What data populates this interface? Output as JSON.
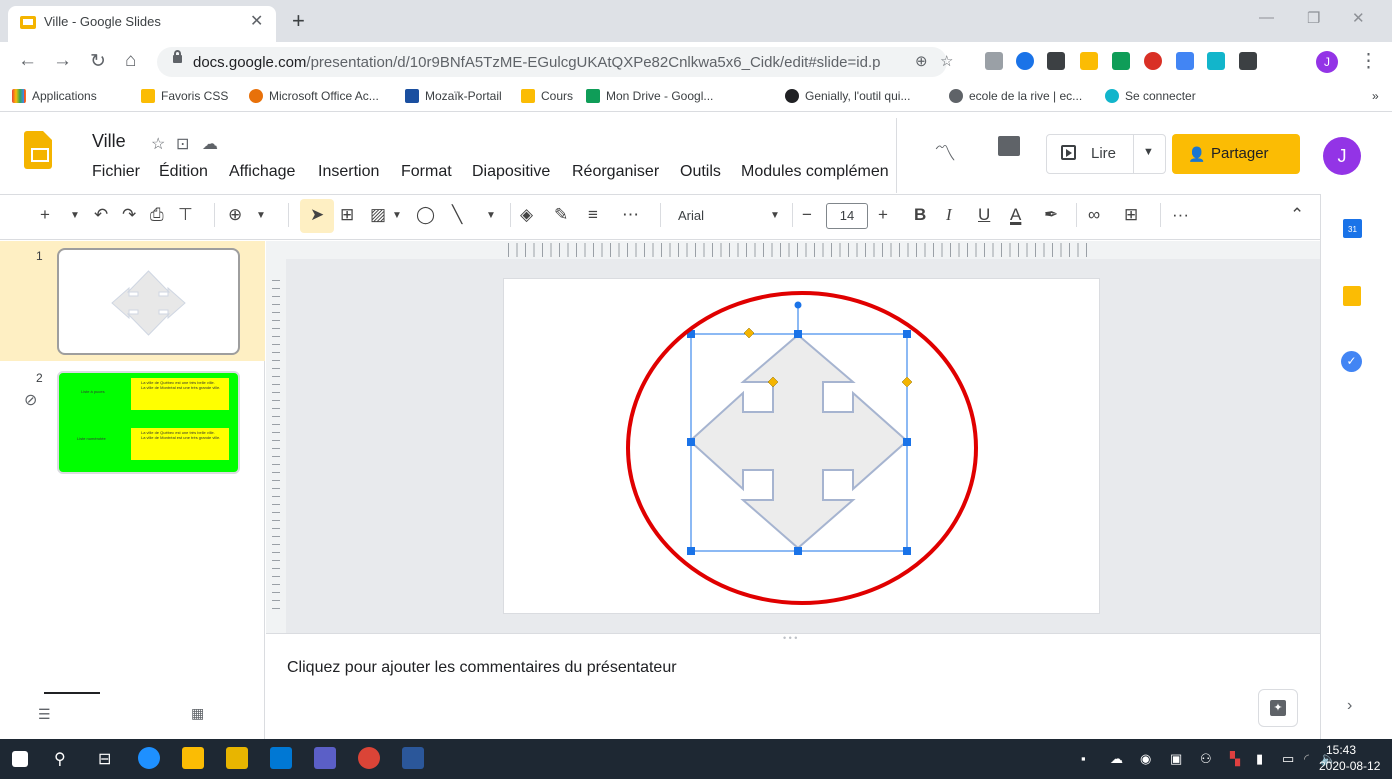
{
  "browser": {
    "tab_title": "Ville - Google Slides",
    "url_host": "docs.google.com",
    "url_path": "/presentation/d/10r9BNfA5TzME-EGulcgUKAtQXPe82Cnlkwa5x6_Cidk/edit#slide=id.p",
    "bookmarks": [
      "Applications",
      "Favoris CSS",
      "Microsoft Office Ac...",
      "Mozaïk-Portail",
      "Cours",
      "Mon Drive - Googl...",
      "Genially, l'outil qui...",
      "ecole de la rive | ec...",
      "Se connecter"
    ],
    "bookmarks_more": "»",
    "profile_initial": "J"
  },
  "doc": {
    "title": "Ville",
    "menus": [
      "Fichier",
      "Édition",
      "Affichage",
      "Insertion",
      "Format",
      "Diapositive",
      "Réorganiser",
      "Outils",
      "Modules complémen"
    ]
  },
  "header": {
    "lire_label": "Lire",
    "share_label": "Partager",
    "avatar_initial": "J"
  },
  "toolbar": {
    "font": "Arial",
    "font_size": "14",
    "more": "···"
  },
  "filmstrip": {
    "slides": [
      {
        "number": "1"
      },
      {
        "number": "2",
        "left_label_1": "Liste à puces",
        "bullets": [
          "La ville de Québec est une très belle ville.",
          "La ville de Montréal est une très grande ville."
        ],
        "left_label_2": "Liste numérotée",
        "numbered": [
          "La ville de Québec est une très belle ville.",
          "La ville de Montréal est une très grande ville."
        ]
      }
    ]
  },
  "notes": {
    "placeholder": "Cliquez pour ajouter les commentaires du présentateur"
  },
  "sidepanel": {
    "calendar_label": "31"
  },
  "taskbar": {
    "time": "15:43",
    "date": "2020-08-12"
  },
  "colors": {
    "accent_yellow": "#fbbc04",
    "selection_blue": "#1a73e8",
    "annotation_red": "#e00000",
    "shape_fill": "#ececec",
    "shape_stroke": "#a6b4d0",
    "thumb2_bg": "#00ff00"
  }
}
